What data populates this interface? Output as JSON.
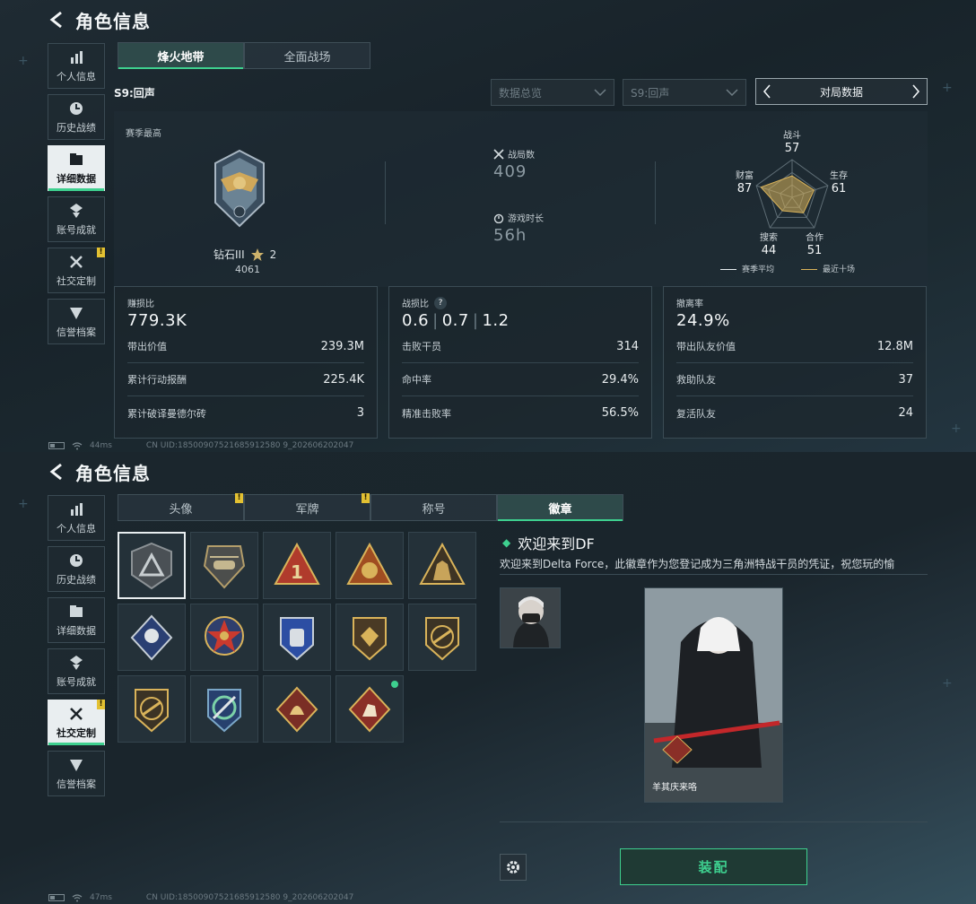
{
  "top": {
    "title": "角色信息",
    "sidebar": [
      {
        "label": "个人信息",
        "icon": "bar-chart-icon",
        "active": false,
        "warn": false
      },
      {
        "label": "历史战绩",
        "icon": "clock-icon",
        "active": false,
        "warn": false
      },
      {
        "label": "详细数据",
        "icon": "folder-icon",
        "active": true,
        "warn": false
      },
      {
        "label": "账号成就",
        "icon": "achievement-icon",
        "active": false,
        "warn": false
      },
      {
        "label": "社交定制",
        "icon": "tools-icon",
        "active": false,
        "warn": true
      },
      {
        "label": "信誉档案",
        "icon": "credit-icon",
        "active": false,
        "warn": false
      }
    ],
    "tabs": [
      "烽火地带",
      "全面战场"
    ],
    "season": "S9:回声",
    "filters": {
      "overview": "数据总览",
      "season": "S9:回声",
      "pager": "对局数据"
    },
    "rank": {
      "label": "赛季最高",
      "tier": "钻石III",
      "stars": "2",
      "score": "4061"
    },
    "matches": {
      "label": "战局数",
      "value": "409"
    },
    "playtime": {
      "label": "游戏时长",
      "value": "56h"
    },
    "radar": {
      "combat": {
        "label": "战斗",
        "value": "57"
      },
      "survive": {
        "label": "生存",
        "value": "61"
      },
      "coop": {
        "label": "合作",
        "value": "51"
      },
      "search": {
        "label": "搜索",
        "value": "44"
      },
      "wealth": {
        "label": "财富",
        "value": "87"
      },
      "legend_avg": "赛季平均",
      "legend_recent": "最近十场",
      "avg_color": "#e9eef0",
      "recent_color": "#d9b35a"
    },
    "cards": [
      {
        "head_label": "赚损比",
        "head_value": "779.3K",
        "rows": [
          {
            "k": "带出价值",
            "v": "239.3M"
          },
          {
            "k": "累计行动报酬",
            "v": "225.4K"
          },
          {
            "k": "累计破译曼德尔砖",
            "v": "3"
          }
        ]
      },
      {
        "head_label": "战损比",
        "head_values": [
          "0.6",
          "0.7",
          "1.2"
        ],
        "help": "?",
        "rows": [
          {
            "k": "击败干员",
            "v": "314"
          },
          {
            "k": "命中率",
            "v": "29.4%"
          },
          {
            "k": "精准击败率",
            "v": "56.5%"
          }
        ]
      },
      {
        "head_label": "撤离率",
        "head_value": "24.9%",
        "rows": [
          {
            "k": "带出队友价值",
            "v": "12.8M"
          },
          {
            "k": "救助队友",
            "v": "37"
          },
          {
            "k": "复活队友",
            "v": "24"
          }
        ]
      }
    ],
    "status": {
      "ping": "44ms",
      "uid": "CN UID:18500907521685912580 9_202606202047"
    }
  },
  "bottom": {
    "title": "角色信息",
    "tabs": [
      {
        "label": "头像",
        "warn": true
      },
      {
        "label": "军牌",
        "warn": true
      },
      {
        "label": "称号",
        "warn": false
      },
      {
        "label": "徽章",
        "warn": false,
        "active": true
      }
    ],
    "detail": {
      "title": "欢迎来到DF",
      "desc": "欢迎来到Delta Force，此徽章作为您登记成为三角洲特战干员的凭证，祝您玩的愉",
      "card_name": "羊其庆来咯",
      "equip": "装配"
    },
    "status": {
      "ping": "47ms",
      "uid": "CN UID:18500907521685912580 9_202606202047"
    }
  }
}
